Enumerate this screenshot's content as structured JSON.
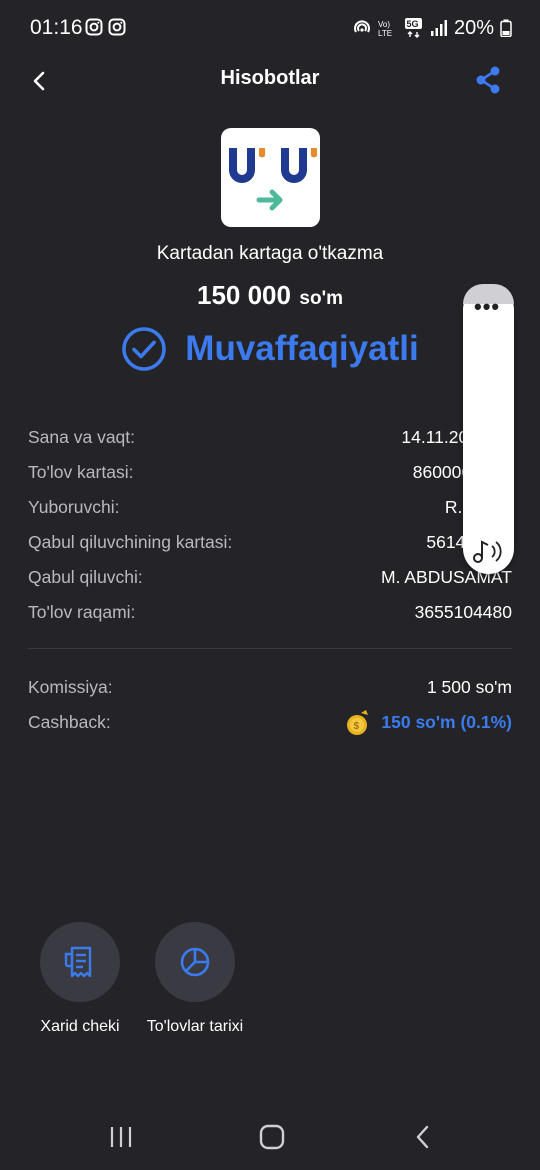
{
  "status_bar": {
    "time": "01:16",
    "battery": "20%",
    "network": "5G"
  },
  "header": {
    "title": "Hisobotlar"
  },
  "hero": {
    "transfer_type": "Kartadan kartaga o'tkazma",
    "amount": "150 000",
    "currency": "so'm",
    "status": "Muvaffaqiyatli"
  },
  "details": [
    {
      "label": "Sana va vaqt:",
      "value": "14.11.2024 01"
    },
    {
      "label": "To'lov kartasi:",
      "value": "860006******"
    },
    {
      "label": "Yuboruvchi:",
      "value": "R. MIRD"
    },
    {
      "label": "Qabul qiluvchining kartasi:",
      "value": "561468****"
    },
    {
      "label": "Qabul qiluvchi:",
      "value": "M. ABDUSAMAT"
    },
    {
      "label": "To'lov raqami:",
      "value": "3655104480"
    }
  ],
  "fees": {
    "commission_label": "Komissiya:",
    "commission_value": "1 500 so'm",
    "cashback_label": "Cashback:",
    "cashback_value": "150 so'm (0.1%)"
  },
  "actions": {
    "receipt_label": "Xarid cheki",
    "history_label": "To'lovlar tarixi"
  },
  "colors": {
    "background": "#242428",
    "accent": "#3b7bee",
    "label": "#b8b9c0",
    "button_bg": "#3a3b42"
  }
}
